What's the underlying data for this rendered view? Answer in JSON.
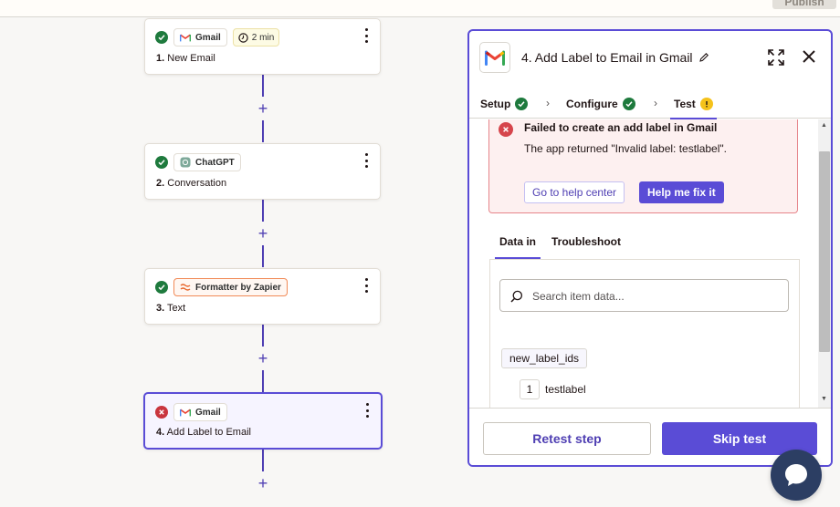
{
  "topbar": {
    "publish_label": "Publish"
  },
  "steps": [
    {
      "app": "Gmail",
      "time": "2 min",
      "number": "1.",
      "title": "New Email",
      "status": "ok"
    },
    {
      "app": "ChatGPT",
      "number": "2.",
      "title": "Conversation",
      "status": "ok"
    },
    {
      "app": "Formatter by Zapier",
      "number": "3.",
      "title": "Text",
      "status": "ok"
    },
    {
      "app": "Gmail",
      "number": "4.",
      "title": "Add Label to Email",
      "status": "error"
    }
  ],
  "panel": {
    "title": "4. Add Label to Email in Gmail",
    "tabs": [
      {
        "label": "Setup",
        "status": "ok"
      },
      {
        "label": "Configure",
        "status": "ok"
      },
      {
        "label": "Test",
        "status": "warning"
      }
    ],
    "error": {
      "title": "Failed to create an add label in Gmail",
      "message": "The app returned \"Invalid label: testlabel\".",
      "help_center_label": "Go to help center",
      "fix_label": "Help me fix it"
    },
    "subtabs": [
      "Data in",
      "Troubleshoot"
    ],
    "search": {
      "placeholder": "Search item data..."
    },
    "data": {
      "key": "new_label_ids",
      "index": "1",
      "value": "testlabel"
    },
    "footer": {
      "retest_label": "Retest step",
      "skip_label": "Skip test"
    }
  },
  "colors": {
    "accent": "#5a4cd6",
    "success": "#1e7a3d",
    "error": "#c9353e",
    "warning": "#f5c21b"
  }
}
